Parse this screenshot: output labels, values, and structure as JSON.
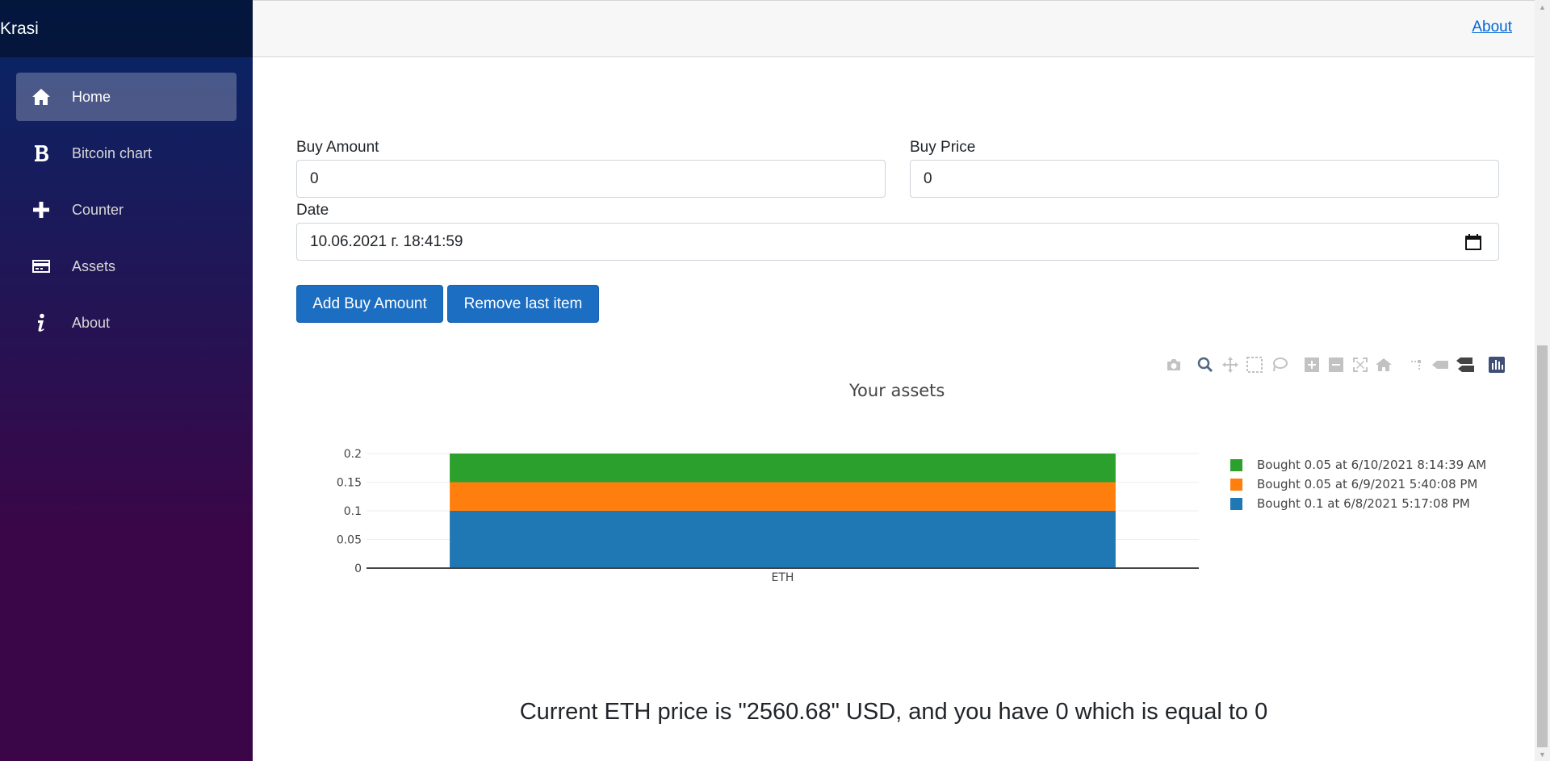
{
  "sidebar": {
    "brand": "Krasi",
    "items": [
      {
        "label": "Home",
        "icon": "home-icon",
        "active": true
      },
      {
        "label": "Bitcoin chart",
        "icon": "bitcoin-icon",
        "active": false
      },
      {
        "label": "Counter",
        "icon": "plus-icon",
        "active": false
      },
      {
        "label": "Assets",
        "icon": "credit-card-icon",
        "active": false
      },
      {
        "label": "About",
        "icon": "info-icon",
        "active": false
      }
    ]
  },
  "header": {
    "about_link": "About"
  },
  "form": {
    "buy_amount_label": "Buy Amount",
    "buy_amount_value": "0",
    "buy_price_label": "Buy Price",
    "buy_price_value": "0",
    "date_label": "Date",
    "date_value": "10.06.2021 г. 18:41:59",
    "add_button": "Add Buy Amount",
    "remove_button": "Remove last item"
  },
  "modebar_icons": [
    "camera-icon",
    "zoom-icon",
    "pan-icon",
    "box-select-icon",
    "lasso-select-icon",
    "zoom-in-icon",
    "zoom-out-icon",
    "autoscale-icon",
    "reset-axes-icon",
    "spike-lines-icon",
    "hover-closest-icon",
    "hover-compare-icon",
    "plotly-logo-icon"
  ],
  "chart_data": {
    "type": "bar",
    "stacked": true,
    "title": "Your assets",
    "categories": [
      "ETH"
    ],
    "ylim": [
      0,
      0.2
    ],
    "yticks": [
      "0",
      "0.05",
      "0.1",
      "0.15",
      "0.2"
    ],
    "grid": true,
    "legend_position": "right",
    "series": [
      {
        "name": "Bought 0.1 at 6/8/2021 5:17:08 PM",
        "values": [
          0.1
        ],
        "color": "#1f77b4"
      },
      {
        "name": "Bought 0.05 at 6/9/2021 5:40:08 PM",
        "values": [
          0.05
        ],
        "color": "#ff7f0e"
      },
      {
        "name": "Bought 0.05 at 6/10/2021 8:14:39 AM",
        "values": [
          0.05
        ],
        "color": "#2ca02c"
      }
    ]
  },
  "footer": {
    "text": "Current ETH price is \"2560.68\" USD, and you have 0 which is equal to 0"
  }
}
